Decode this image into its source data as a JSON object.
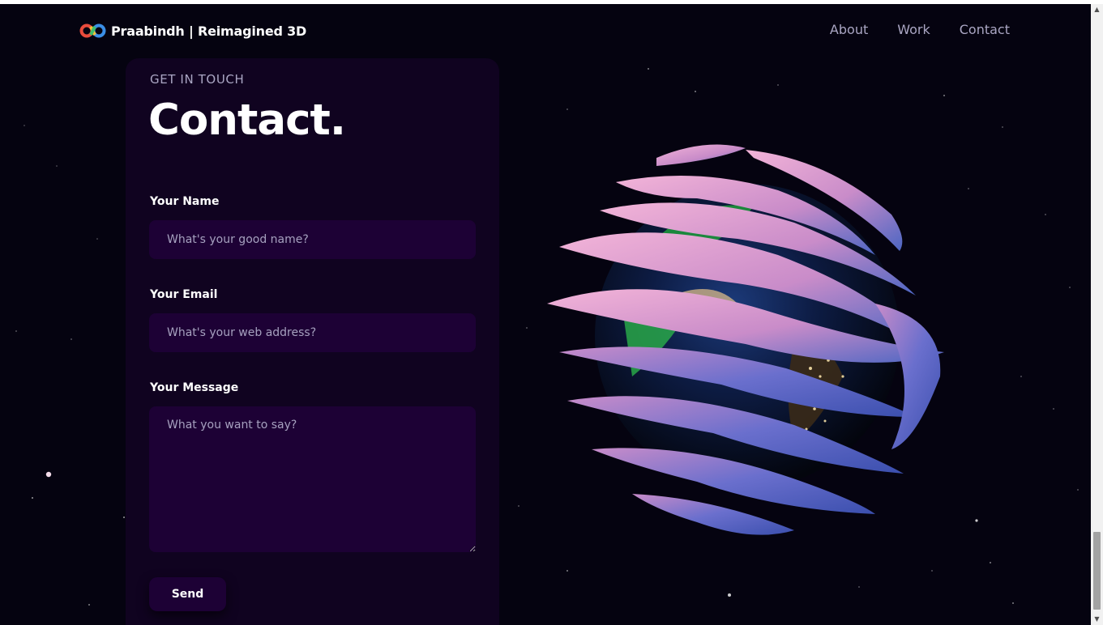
{
  "brand": {
    "title": "Praabindh | Reimagined 3D",
    "logo_icon": "infinity-logo-icon"
  },
  "nav": {
    "links": [
      {
        "label": "About"
      },
      {
        "label": "Work"
      },
      {
        "label": "Contact"
      }
    ]
  },
  "contact": {
    "subtitle": "GET IN TOUCH",
    "title": "Contact.",
    "name_label": "Your Name",
    "name_placeholder": "What's your good name?",
    "email_label": "Your Email",
    "email_placeholder": "What's your web address?",
    "message_label": "Your Message",
    "message_placeholder": "What you want to say?",
    "send_label": "Send"
  },
  "colors": {
    "background": "#050310",
    "panel": "#100320",
    "input": "#1d0135",
    "secondary_text": "#aaa6c3"
  }
}
